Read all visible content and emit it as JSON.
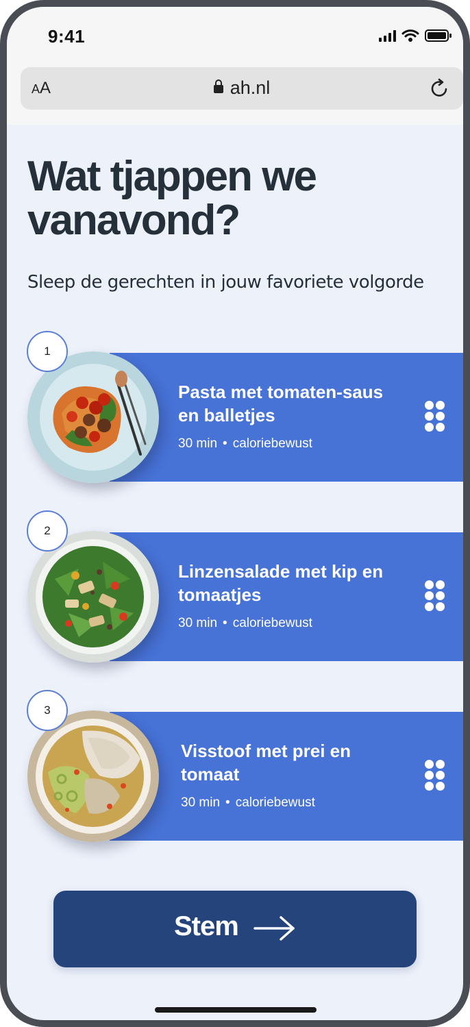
{
  "status_bar": {
    "time": "9:41"
  },
  "browser": {
    "text_size": {
      "small": "A",
      "large": "A"
    },
    "url": "ah.nl"
  },
  "page": {
    "title": "Wat tjappen we vanavond?",
    "subtitle": "Sleep de gerechten in jouw favoriete volgorde"
  },
  "dishes": [
    {
      "rank": "1",
      "name": "Pasta met tomaten-saus en balletjes",
      "time": "30 min",
      "tag": "caloriebewust"
    },
    {
      "rank": "2",
      "name": "Linzensalade met kip en tomaatjes",
      "time": "30 min",
      "tag": "caloriebewust"
    },
    {
      "rank": "3",
      "name": "Visstoof met prei en tomaat",
      "time": "30 min",
      "tag": "caloriebewust"
    }
  ],
  "meta_separator": "•",
  "cta": {
    "label": "Stem"
  },
  "colors": {
    "card": "#4772d6",
    "button": "#24447b",
    "background": "#edf1fa",
    "text": "#25303a"
  }
}
